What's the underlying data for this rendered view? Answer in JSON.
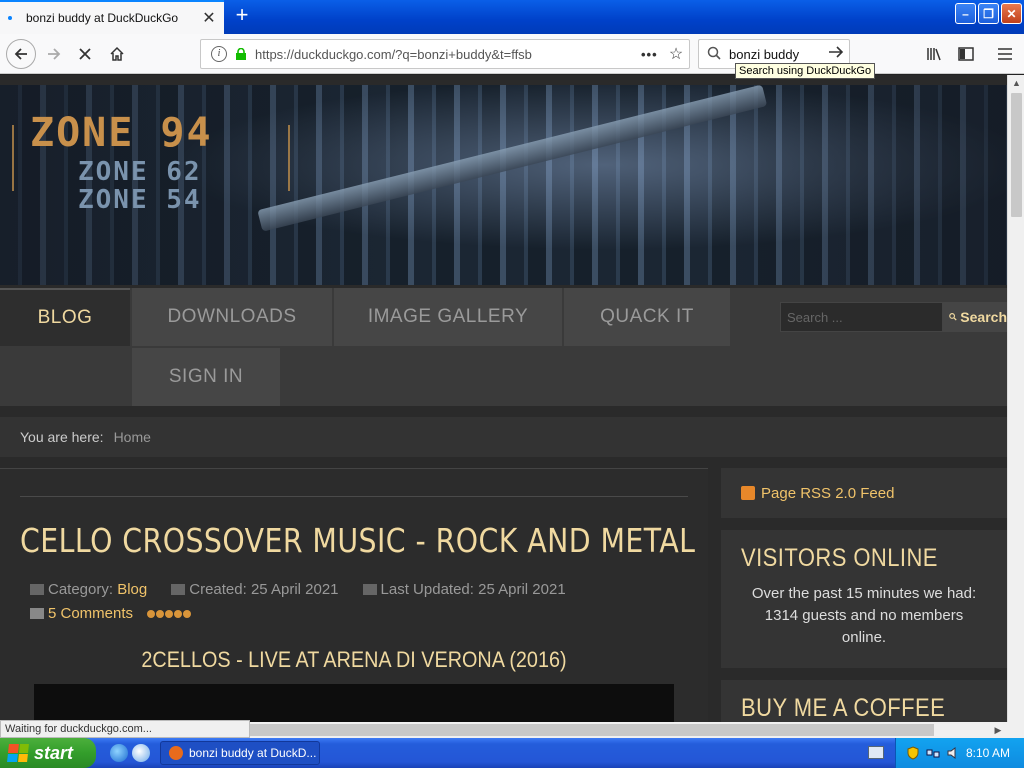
{
  "browser": {
    "tab_title": "bonzi buddy at DuckDuckGo",
    "url": "https://duckduckgo.com/?q=bonzi+buddy&t=ffsb",
    "search_query": "bonzi buddy",
    "tooltip": "Search using DuckDuckGo",
    "status": "Waiting for duckduckgo.com..."
  },
  "site": {
    "logo": [
      "ZONE 94",
      "ZONE 62",
      "ZONE 54"
    ],
    "menu": [
      "BLOG",
      "DOWNLOADS",
      "IMAGE GALLERY",
      "QUACK IT",
      "SIGN IN"
    ],
    "search_placeholder": "Search ...",
    "search_button": "Search",
    "breadcrumb_label": "You are here:",
    "breadcrumb_home": "Home"
  },
  "article": {
    "title": "CELLO CROSSOVER MUSIC - ROCK AND METAL",
    "category_label": "Category:",
    "category": "Blog",
    "created": "Created: 25 April 2021",
    "updated": "Last Updated: 25 April 2021",
    "comments": "5 Comments",
    "rating": 5,
    "subheading": "2CELLOS - LIVE AT ARENA DI VERONA (2016)"
  },
  "sidebar": {
    "rss": "Page RSS 2.0 Feed",
    "visitors_heading": "VISITORS ONLINE",
    "visitors_text": "Over the past 15 minutes we had: 1314 guests and no members online.",
    "coffee_heading": "BUY ME A COFFEE"
  },
  "taskbar": {
    "start": "start",
    "task": "bonzi buddy at DuckD...",
    "clock": "8:10 AM"
  }
}
